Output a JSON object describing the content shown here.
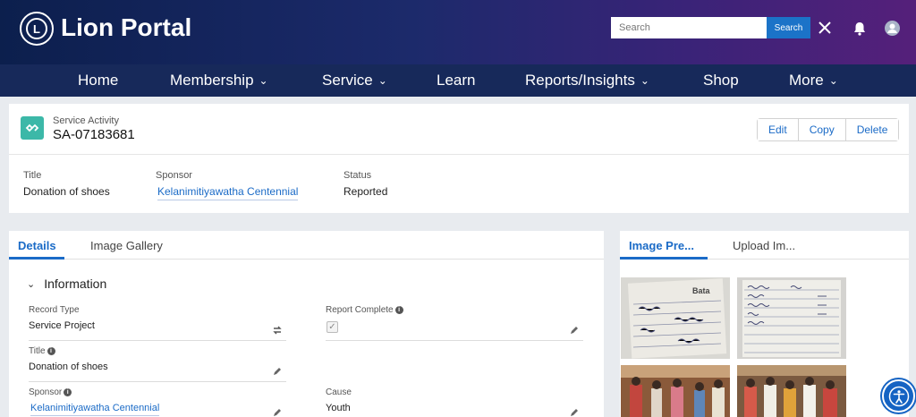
{
  "header": {
    "brand": "Lion Portal",
    "logo_text": "L",
    "search_placeholder": "Search",
    "search_button": "Search"
  },
  "nav": {
    "items": [
      {
        "label": "Home",
        "dropdown": false
      },
      {
        "label": "Membership",
        "dropdown": true
      },
      {
        "label": "Service",
        "dropdown": true
      },
      {
        "label": "Learn",
        "dropdown": false
      },
      {
        "label": "Reports/Insights",
        "dropdown": true
      },
      {
        "label": "Shop",
        "dropdown": false
      },
      {
        "label": "More",
        "dropdown": true
      }
    ]
  },
  "record": {
    "type": "Service Activity",
    "name": "SA-07183681",
    "actions": [
      "Edit",
      "Copy",
      "Delete"
    ]
  },
  "highlights": {
    "title_label": "Title",
    "title_value": "Donation of shoes",
    "sponsor_label": "Sponsor",
    "sponsor_value": "Kelanimitiyawatha Centennial",
    "status_label": "Status",
    "status_value": "Reported"
  },
  "details": {
    "tabs": [
      "Details",
      "Image Gallery"
    ],
    "section": "Information",
    "fields": {
      "record_type_label": "Record Type",
      "record_type_value": "Service Project",
      "report_complete_label": "Report Complete",
      "report_complete_checked": true,
      "title_label": "Title",
      "title_value": "Donation of shoes",
      "sponsor_label": "Sponsor",
      "sponsor_value": "Kelanimitiyawatha Centennial",
      "cause_label": "Cause",
      "cause_value": "Youth"
    }
  },
  "image_panel": {
    "tabs": [
      "Image Pre...",
      "Upload Im..."
    ]
  },
  "colors": {
    "header_start": "#0c1f4d",
    "header_end": "#55207a",
    "nav": "#17295a",
    "accent": "#1b6bc7",
    "record_icon": "#3cb8a8"
  },
  "icons": [
    "search-close-icon",
    "bell-icon",
    "user-avatar-icon",
    "record-icon",
    "change-record-type-icon",
    "pencil-icon",
    "info-icon",
    "chevron-down-icon",
    "accessibility-icon"
  ]
}
